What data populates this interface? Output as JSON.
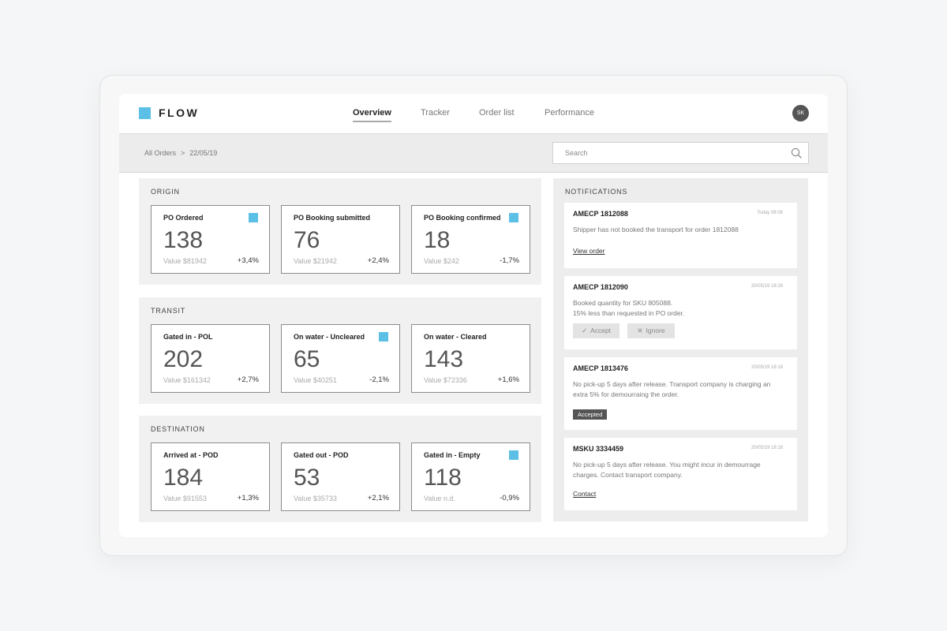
{
  "app": {
    "name": "FLOW",
    "brand_color": "#5cc0e6"
  },
  "nav": {
    "tabs": [
      {
        "label": "Overview",
        "active": true
      },
      {
        "label": "Tracker",
        "active": false
      },
      {
        "label": "Order list",
        "active": false
      },
      {
        "label": "Performance",
        "active": false
      }
    ]
  },
  "user": {
    "initials": "SK"
  },
  "breadcrumb": {
    "root": "All Orders",
    "separator": ">",
    "current": "22/05/19"
  },
  "search": {
    "placeholder": "Search",
    "value": ""
  },
  "sections": [
    {
      "title": "ORIGIN",
      "cards": [
        {
          "title": "PO Ordered",
          "count": "138",
          "value": "Value $81942",
          "change": "+3,4%",
          "flagged": true
        },
        {
          "title": "PO Booking submitted",
          "count": "76",
          "value": "Value $21942",
          "change": "+2,4%",
          "flagged": false
        },
        {
          "title": "PO Booking confirmed",
          "count": "18",
          "value": "Value $242",
          "change": "-1,7%",
          "flagged": true
        }
      ]
    },
    {
      "title": "TRANSIT",
      "cards": [
        {
          "title": "Gated in - POL",
          "count": "202",
          "value": "Value $161342",
          "change": "+2,7%",
          "flagged": false
        },
        {
          "title": "On water - Uncleared",
          "count": "65",
          "value": "Value $40251",
          "change": "-2,1%",
          "flagged": true
        },
        {
          "title": "On water - Cleared",
          "count": "143",
          "value": "Value $72336",
          "change": "+1,6%",
          "flagged": false
        }
      ]
    },
    {
      "title": "DESTINATION",
      "cards": [
        {
          "title": "Arrived at - POD",
          "count": "184",
          "value": "Value $91553",
          "change": "+1,3%",
          "flagged": false
        },
        {
          "title": "Gated out - POD",
          "count": "53",
          "value": "Value $35733",
          "change": "+2,1%",
          "flagged": false
        },
        {
          "title": "Gated in - Empty",
          "count": "118",
          "value": "Value n.d.",
          "change": "-0,9%",
          "flagged": true
        }
      ]
    }
  ],
  "notifications": {
    "heading": "NOTIFICATIONS",
    "items": [
      {
        "id": "AMECP 1812088",
        "time": "Today 08:08",
        "message": "Shipper has not booked the transport for order 1812088",
        "link": "View order"
      },
      {
        "id": "AMECP 1812090",
        "time": "20/05/19 18:16",
        "message": "Booked quantity for SKU 805088.\n15% less than requested in PO order.",
        "accept_label": "Accept",
        "ignore_label": "Ignore",
        "accept_icon": "check-icon",
        "ignore_icon": "close-icon"
      },
      {
        "id": "AMECP 1813476",
        "time": "20/05/19 18:16",
        "message": "No pick-up 5 days after release. Transport company is charging an extra 5% for demourraing the order.",
        "badge": "Accepted"
      },
      {
        "id": "MSKU 3334459",
        "time": "20/05/19 18:16",
        "message": "No pick-up 5 days after release. You might incur in demourrage charges. Contact transport company.",
        "link": "Contact"
      }
    ]
  }
}
